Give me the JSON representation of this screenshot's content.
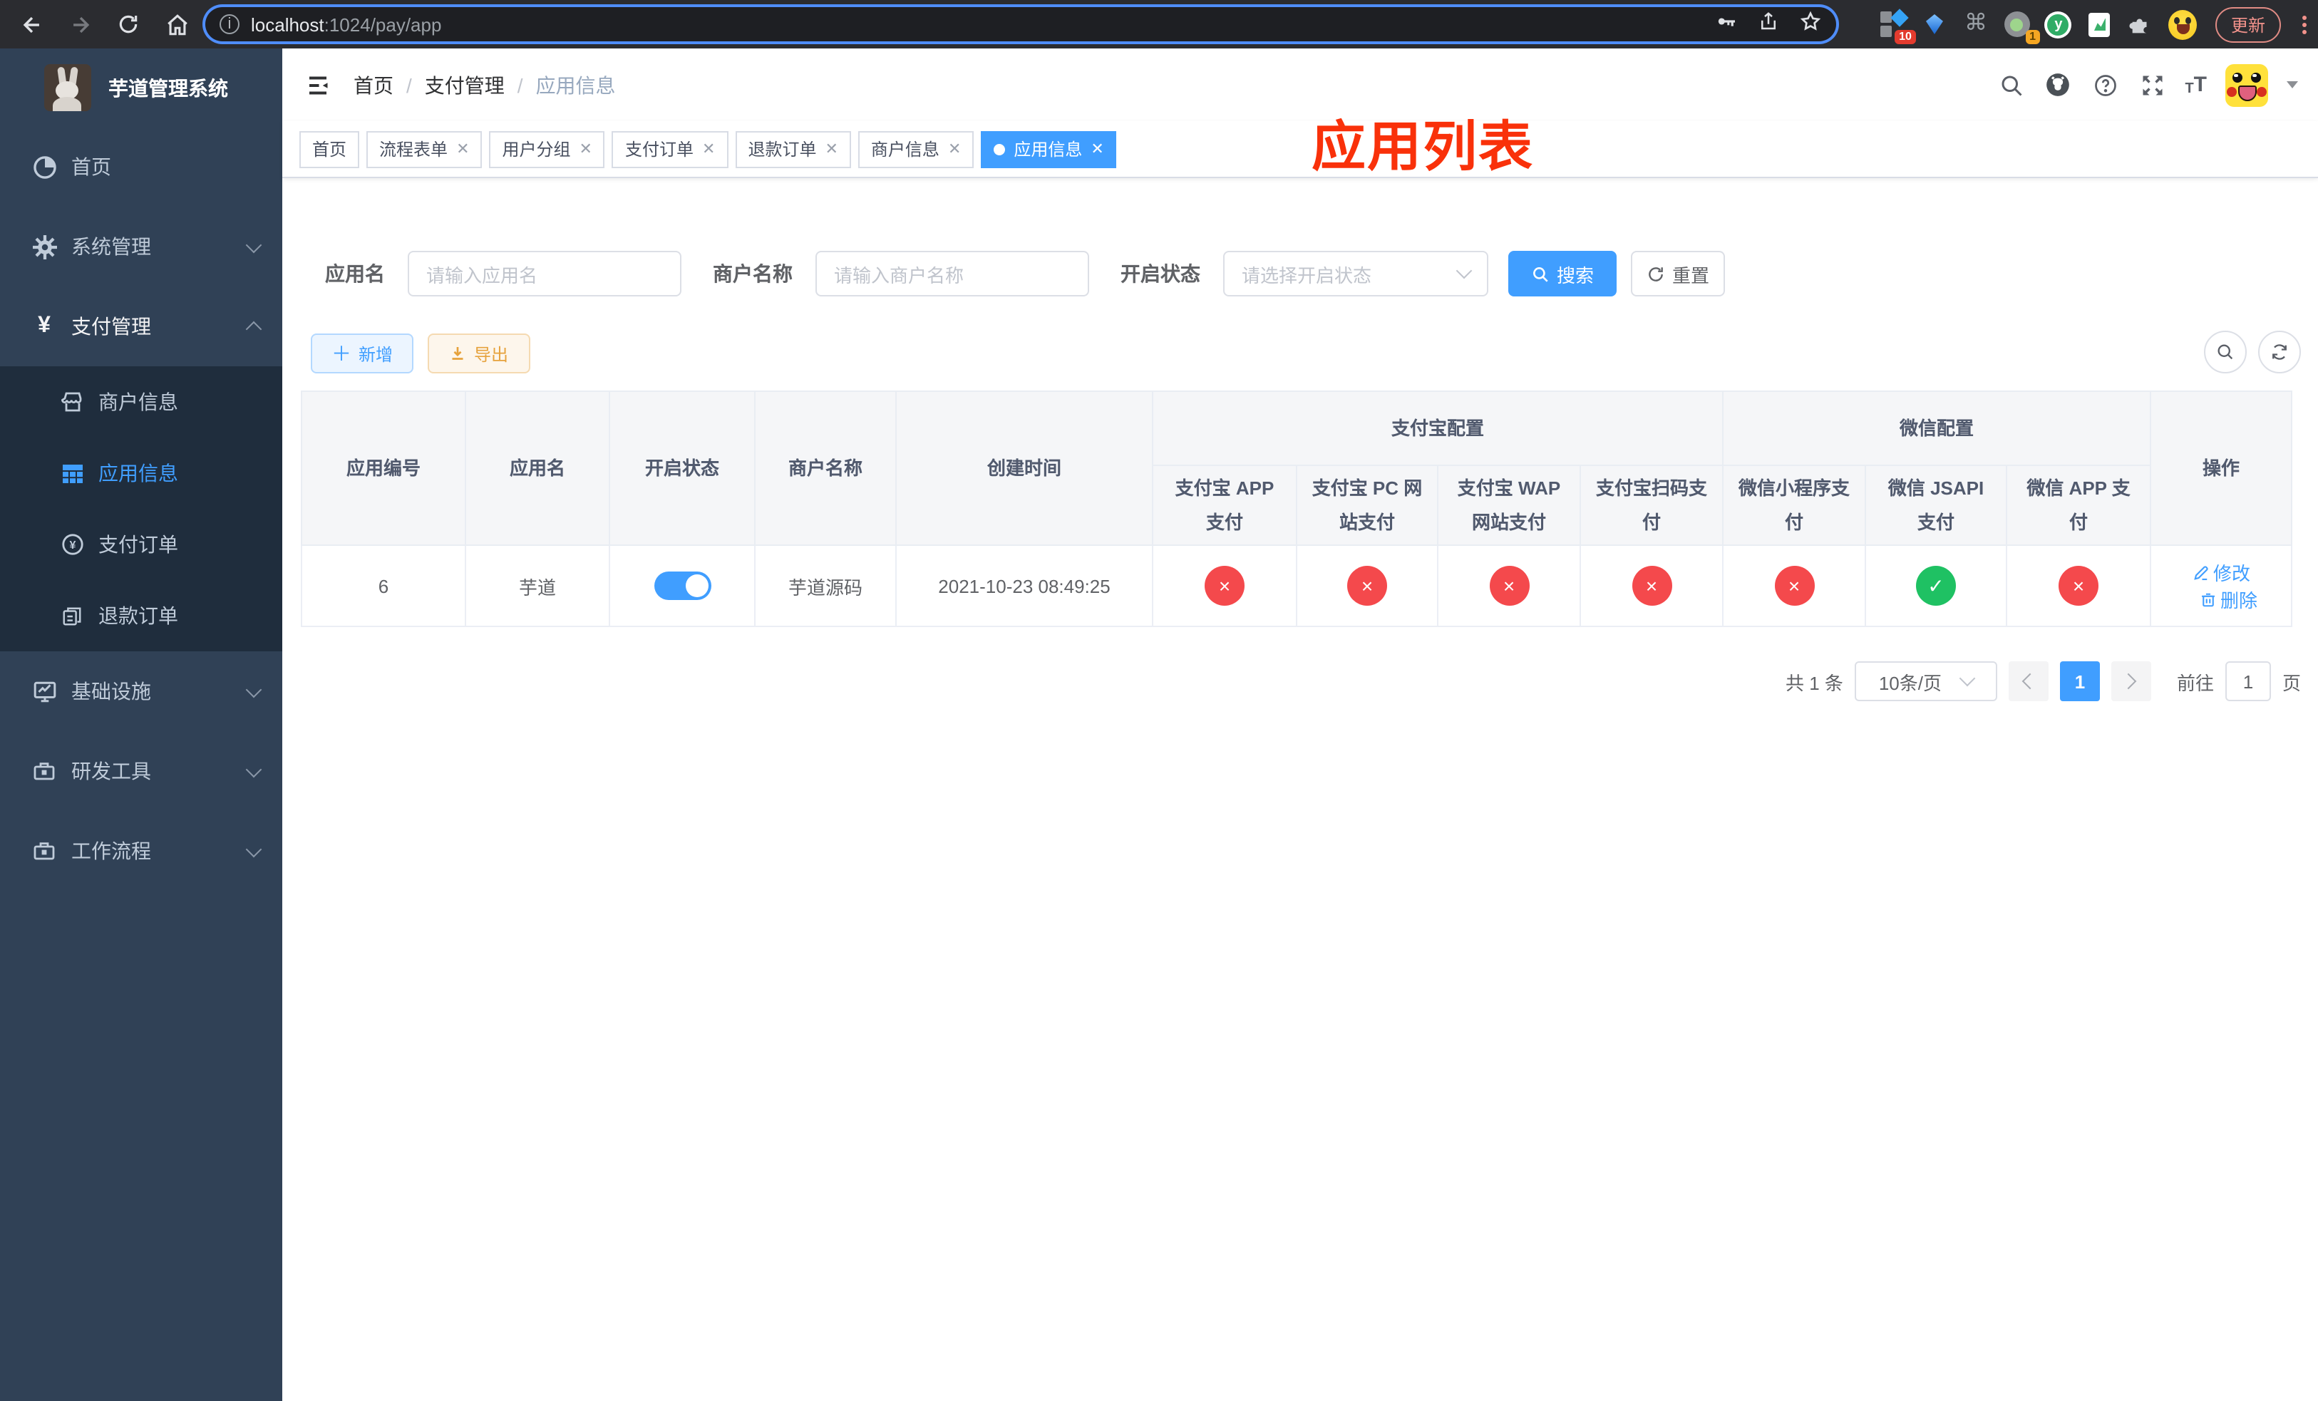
{
  "browser": {
    "url_host": "localhost",
    "url_rest": ":1024/pay/app",
    "update_label": "更新",
    "ext_badge_blocks": "10",
    "ext_badge_target": "1",
    "ext_y_letter": "y"
  },
  "annotation": {
    "text": "应用列表",
    "color": "#f9310a"
  },
  "sidebar": {
    "title": "芋道管理系统",
    "home": "首页",
    "system": "系统管理",
    "payment": "支付管理",
    "sub_merchant": "商户信息",
    "sub_app": "应用信息",
    "sub_order": "支付订单",
    "sub_refund": "退款订单",
    "infra": "基础设施",
    "devtools": "研发工具",
    "workflow": "工作流程"
  },
  "navbar": {
    "breadcrumbs": [
      "首页",
      "支付管理",
      "应用信息"
    ]
  },
  "tabs": [
    {
      "label": "首页",
      "closable": false,
      "active": false
    },
    {
      "label": "流程表单",
      "closable": true,
      "active": false
    },
    {
      "label": "用户分组",
      "closable": true,
      "active": false
    },
    {
      "label": "支付订单",
      "closable": true,
      "active": false
    },
    {
      "label": "退款订单",
      "closable": true,
      "active": false
    },
    {
      "label": "商户信息",
      "closable": true,
      "active": false
    },
    {
      "label": "应用信息",
      "closable": true,
      "active": true
    }
  ],
  "filters": {
    "app_name_label": "应用名",
    "app_name_placeholder": "请输入应用名",
    "merchant_label": "商户名称",
    "merchant_placeholder": "请输入商户名称",
    "status_label": "开启状态",
    "status_placeholder": "请选择开启状态",
    "search_label": "搜索",
    "reset_label": "重置"
  },
  "toolbar": {
    "add_label": "新增",
    "export_label": "导出"
  },
  "table": {
    "group_alipay": "支付宝配置",
    "group_wechat": "微信配置",
    "columns": [
      "应用编号",
      "应用名",
      "开启状态",
      "商户名称",
      "创建时间",
      "支付宝 APP 支付",
      "支付宝 PC 网站支付",
      "支付宝 WAP 网站支付",
      "支付宝扫码支付",
      "微信小程序支付",
      "微信 JSAPI 支付",
      "微信 APP 支付",
      "操作"
    ],
    "rows": [
      {
        "id": "6",
        "name": "芋道",
        "enabled": true,
        "merchant": "芋道源码",
        "created_at": "2021-10-23 08:49:25",
        "pay_status": [
          "fail",
          "fail",
          "fail",
          "fail",
          "fail",
          "success",
          "fail"
        ],
        "edit_label": "修改",
        "delete_label": "删除"
      }
    ]
  },
  "pagination": {
    "total_label": "共 1 条",
    "page_size_label": "10条/页",
    "current_page": "1",
    "goto_label": "前往",
    "goto_value": "1",
    "unit_label": "页"
  }
}
